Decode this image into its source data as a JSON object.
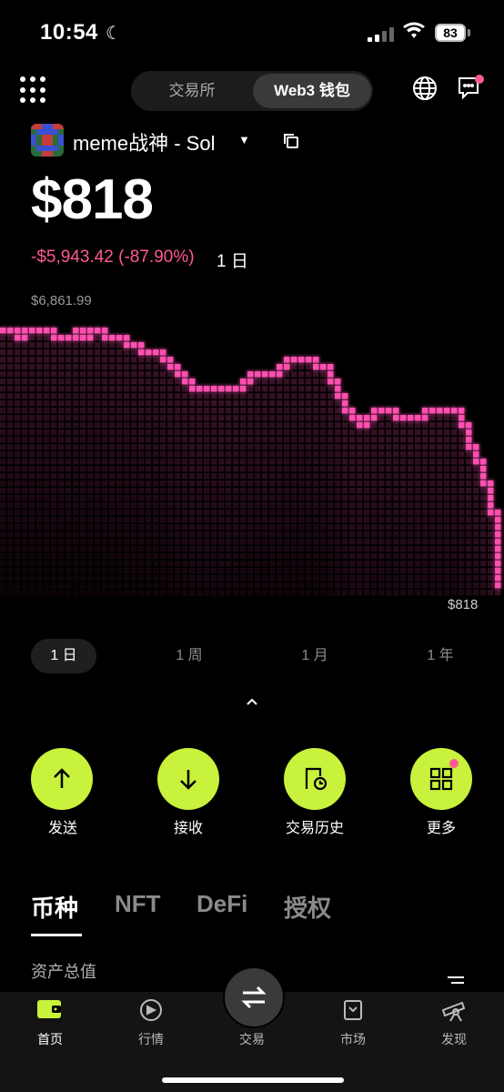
{
  "status": {
    "time": "10:54",
    "battery": "83"
  },
  "header": {
    "segment_left": "交易所",
    "segment_right": "Web3 钱包"
  },
  "wallet": {
    "name": "meme战神 - Sol"
  },
  "balance": {
    "value": "$818",
    "change": "-$5,943.42 (-87.90%)",
    "period": "1 日"
  },
  "chart_data": {
    "type": "line",
    "max_label": "$6,861.99",
    "min_label": "$818",
    "ylim": [
      818,
      6861.99
    ],
    "x": [
      0,
      1,
      2,
      3,
      4,
      5,
      6,
      7,
      8,
      9,
      10,
      11,
      12,
      13,
      14,
      15,
      16,
      17,
      18,
      19,
      20,
      21,
      22,
      23,
      24,
      25,
      26,
      27,
      28,
      29,
      30,
      31,
      32,
      33,
      34,
      35,
      36,
      37,
      38,
      39,
      40,
      41,
      42,
      43,
      44,
      45,
      46,
      47,
      48,
      49,
      50,
      51,
      52,
      53,
      54,
      55,
      56,
      57,
      58,
      59,
      60,
      61,
      62,
      63,
      64,
      65,
      66,
      67,
      68,
      69,
      70,
      71,
      72,
      73,
      74,
      75,
      76,
      77,
      78,
      79
    ],
    "values": [
      6860,
      6860,
      6750,
      6860,
      6860,
      6860,
      6860,
      6750,
      6720,
      6860,
      6750,
      6860,
      6860,
      6750,
      6750,
      6750,
      6580,
      6480,
      6400,
      6500,
      6380,
      6000,
      5880,
      5620,
      5500,
      5430,
      5430,
      5500,
      5530,
      5530,
      5530,
      5700,
      5900,
      5860,
      5860,
      6000,
      6100,
      6200,
      6200,
      6200,
      6090,
      6000,
      5600,
      5100,
      4830,
      4560,
      4780,
      4950,
      4950,
      4950,
      4840,
      4780,
      4700,
      4840,
      4950,
      5050,
      5050,
      5050,
      4740,
      4310,
      3750,
      3280,
      2560,
      818
    ],
    "color": "#ff4fb1"
  },
  "ranges": [
    "1 日",
    "1 周",
    "1 月",
    "1 年"
  ],
  "actions": [
    "发送",
    "接收",
    "交易历史",
    "更多"
  ],
  "tabs": [
    "币种",
    "NFT",
    "DeFi",
    "授权"
  ],
  "section_label": "资产总值",
  "bottom_nav": [
    "首页",
    "行情",
    "交易",
    "市场",
    "发现"
  ]
}
